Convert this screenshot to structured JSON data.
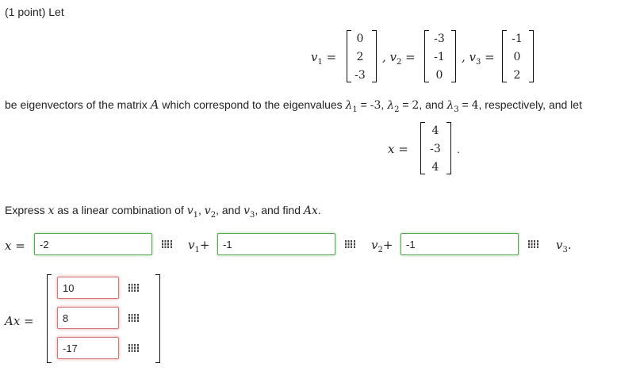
{
  "problem": {
    "points_label": "(1 point) Let",
    "sentence1": "be eigenvectors of the matrix",
    "sentence1_tail": "which correspond to the eigenvalues",
    "and": "and",
    "respectively": "respectively, and let",
    "instruction_a": "Express",
    "instruction_b": "as a linear combination of",
    "instruction_c": "and find",
    "matrix": "A",
    "v1": [
      "0",
      "2",
      "-3"
    ],
    "v2": [
      "-3",
      "-1",
      "0"
    ],
    "v3": [
      "-1",
      "0",
      "2"
    ],
    "x": [
      "4",
      "-3",
      "4"
    ],
    "eigenvalues": [
      "-3",
      "2",
      "4"
    ]
  },
  "answers": {
    "coef1": "-2",
    "coef2": "-1",
    "coef3": "-1",
    "ax": [
      "10",
      "8",
      "-17"
    ]
  },
  "icons": [
    "matrix-grid-icon"
  ]
}
